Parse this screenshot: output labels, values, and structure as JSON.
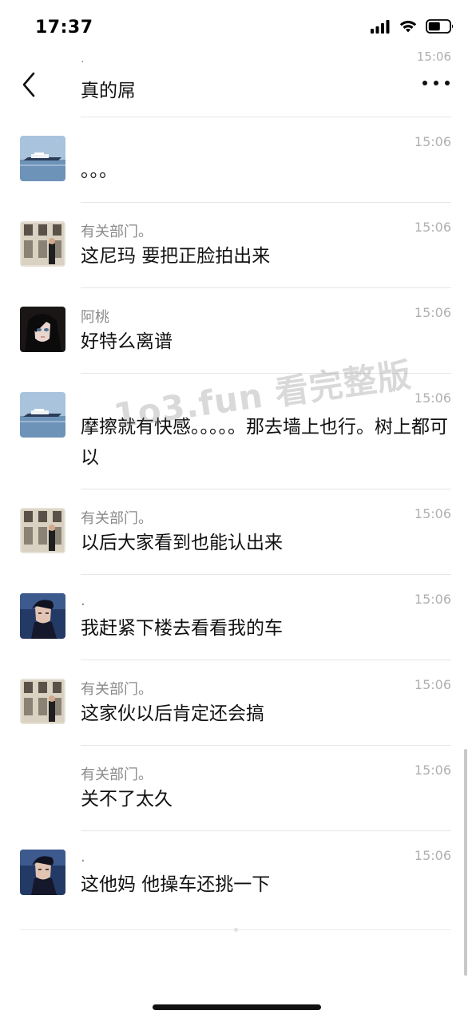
{
  "status_bar": {
    "time": "17:37"
  },
  "nav": {
    "title": "真的屌",
    "ghost_name": ".",
    "ghost_time": "15:06"
  },
  "messages": [
    {
      "name": "",
      "text": "。。。",
      "time": "15:06",
      "avatar": "avatar-boat"
    },
    {
      "name": "有关部门。",
      "text": "这尼玛 要把正脸拍出来",
      "time": "15:06",
      "avatar": "avatar-building"
    },
    {
      "name": "阿桃",
      "text": "好特么离谱",
      "time": "15:06",
      "avatar": "avatar-anime-girl"
    },
    {
      "name": "",
      "text": "摩擦就有快感。。。。。那去墙上也行。树上都可以",
      "time": "15:06",
      "avatar": "avatar-boat"
    },
    {
      "name": "有关部门。",
      "text": "以后大家看到也能认出来",
      "time": "15:06",
      "avatar": "avatar-building"
    },
    {
      "name": ".",
      "text": "我赶紧下楼去看看我的车",
      "time": "15:06",
      "avatar": "avatar-anime-boy"
    },
    {
      "name": "有关部门。",
      "text": "这家伙以后肯定还会搞",
      "time": "15:06",
      "avatar": "avatar-building"
    },
    {
      "name": "有关部门。",
      "text": "关不了太久",
      "time": "15:06",
      "avatar": ""
    },
    {
      "name": ".",
      "text": "这他妈 他操车还挑一下",
      "time": "15:06",
      "avatar": "avatar-anime-boy"
    }
  ],
  "watermark": "1o3.fun 看完整版"
}
